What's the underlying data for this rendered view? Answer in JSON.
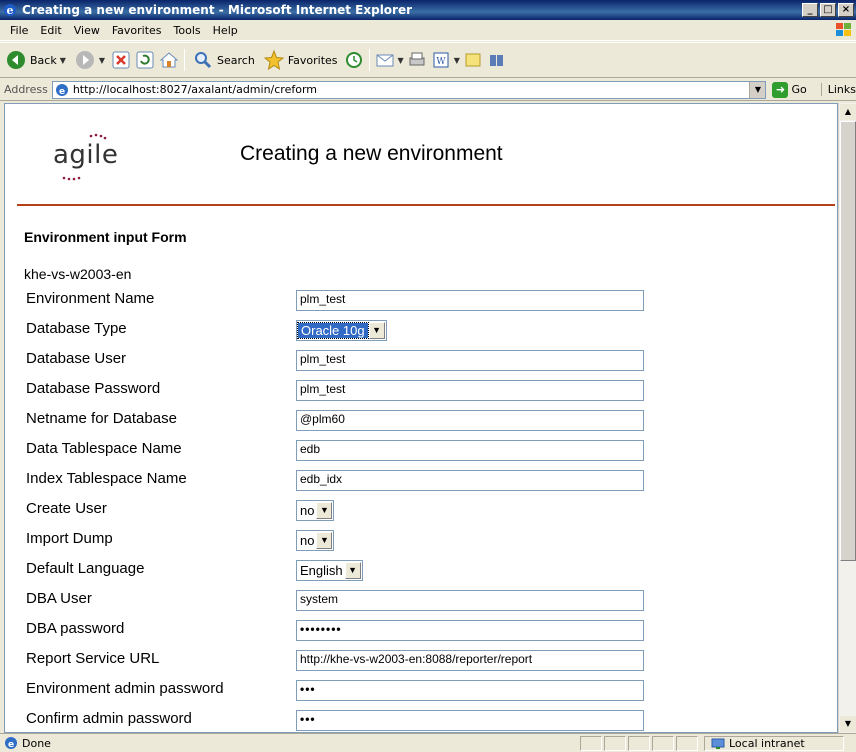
{
  "window": {
    "title": "Creating a new environment - Microsoft Internet Explorer",
    "buttons": [
      "_",
      "□",
      "×"
    ]
  },
  "menu": [
    "File",
    "Edit",
    "View",
    "Favorites",
    "Tools",
    "Help"
  ],
  "toolbar": {
    "back_label": "Back",
    "search_label": "Search",
    "favorites_label": "Favorites"
  },
  "address": {
    "label": "Address",
    "url": "http://localhost:8027/axalant/admin/creform",
    "go_label": "Go",
    "links_label": "Links"
  },
  "page": {
    "logo_text": "agile",
    "title": "Creating a new environment",
    "form_heading": "Environment input Form",
    "host": "khe-vs-w2003-en"
  },
  "form": {
    "environment_name": {
      "label": "Environment Name",
      "value": "plm_test"
    },
    "database_type": {
      "label": "Database Type",
      "value": "Oracle 10g"
    },
    "database_user": {
      "label": "Database User",
      "value": "plm_test"
    },
    "database_password": {
      "label": "Database Password",
      "value": "plm_test"
    },
    "netname": {
      "label": "Netname for Database",
      "value": "@plm60"
    },
    "data_tablespace": {
      "label": "Data Tablespace Name",
      "value": "edb"
    },
    "index_tablespace": {
      "label": "Index Tablespace Name",
      "value": "edb_idx"
    },
    "create_user": {
      "label": "Create User",
      "value": "no"
    },
    "import_dump": {
      "label": "Import Dump",
      "value": "no"
    },
    "default_language": {
      "label": "Default Language",
      "value": "English"
    },
    "dba_user": {
      "label": "DBA User",
      "value": "system"
    },
    "dba_password": {
      "label": "DBA password",
      "value": "••••••••"
    },
    "report_url": {
      "label": "Report Service URL",
      "value": "http://khe-vs-w2003-en:8088/reporter/report"
    },
    "env_admin_password": {
      "label": "Environment admin password",
      "value": "•••"
    },
    "confirm_admin_password": {
      "label": "Confirm admin password",
      "value": "•••"
    }
  },
  "status": {
    "text": "Done",
    "zone": "Local intranet"
  },
  "colors": {
    "titlebar": "#0A246A",
    "divider": "#B5401A",
    "selection": "#316AC5"
  }
}
